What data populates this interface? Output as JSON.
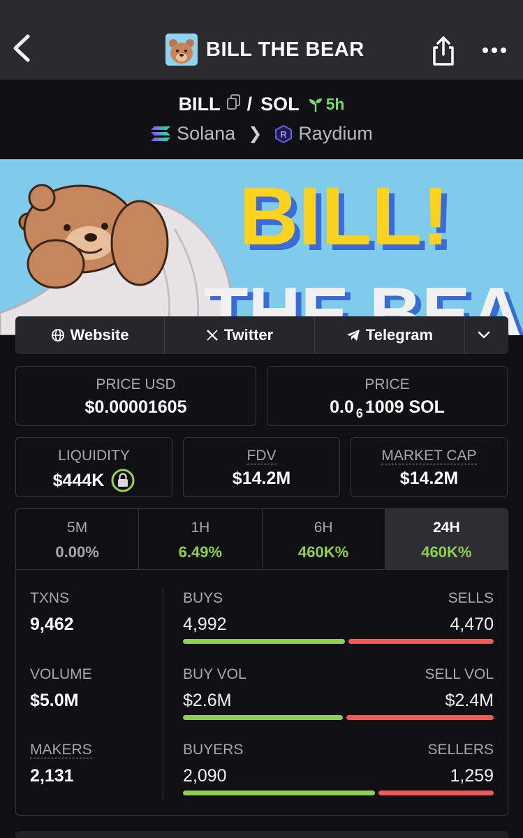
{
  "header": {
    "title": "BILL THE BEAR",
    "back_icon": "chevron-left-icon",
    "share_icon": "share-icon",
    "more_icon": "more-dots-icon"
  },
  "pair": {
    "base": "BILL",
    "separator": "/",
    "quote": "SOL",
    "age": "5h",
    "chain": "Solana",
    "dex": "Raydium"
  },
  "banner": {
    "line1": "BILL!",
    "line2": "THE BEAR"
  },
  "links": {
    "website": "Website",
    "twitter": "Twitter",
    "telegram": "Telegram"
  },
  "prices": {
    "price_usd_label": "PRICE USD",
    "price_usd": "$0.00001605",
    "price_label": "PRICE",
    "price_prefix": "0.0",
    "price_zeros": "6",
    "price_suffix": "1009 SOL"
  },
  "metrics": {
    "liquidity_label": "LIQUIDITY",
    "liquidity": "$444K",
    "fdv_label": "FDV",
    "fdv": "$14.2M",
    "mcap_label": "MARKET CAP",
    "mcap": "$14.2M"
  },
  "timeframes": [
    {
      "label": "5M",
      "value": "0.00%"
    },
    {
      "label": "1H",
      "value": "6.49%"
    },
    {
      "label": "6H",
      "value": "460K%"
    },
    {
      "label": "24H",
      "value": "460K%"
    }
  ],
  "stats": {
    "txns_label": "TXNS",
    "txns": "9,462",
    "volume_label": "VOLUME",
    "volume": "$5.0M",
    "makers_label": "MAKERS",
    "makers": "2,131",
    "buys_label": "BUYS",
    "buys": "4,992",
    "sells_label": "SELLS",
    "sells": "4,470",
    "buy_vol_label": "BUY VOL",
    "buy_vol": "$2.6M",
    "sell_vol_label": "SELL VOL",
    "sell_vol": "$2.4M",
    "buyers_label": "BUYERS",
    "buyers": "2,090",
    "sellers_label": "SELLERS",
    "sellers": "1,259",
    "buys_ratio": 0.528,
    "buy_vol_ratio": 0.52,
    "buyers_ratio": 0.624
  },
  "colors": {
    "positive": "#8fcf55",
    "negative": "#ef5a5a",
    "accent_yellow": "#ffd21f"
  }
}
